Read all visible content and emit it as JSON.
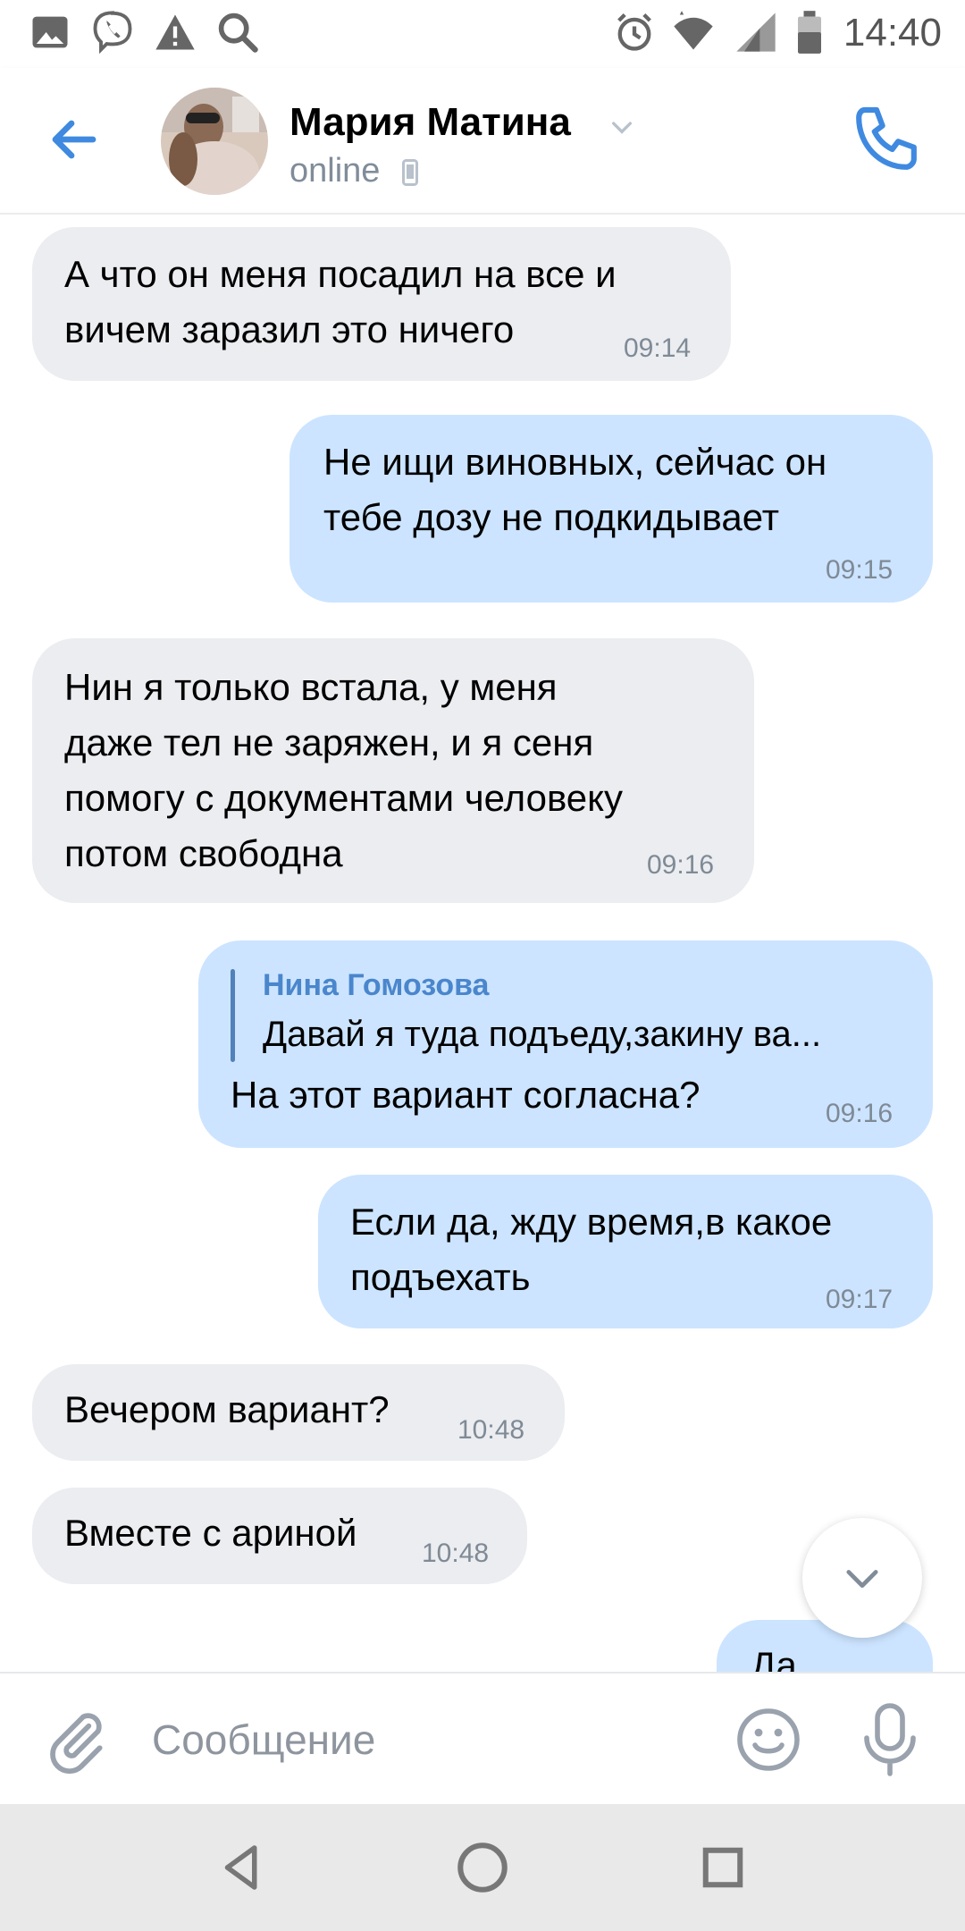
{
  "status_bar": {
    "time": "14:40",
    "icons": [
      "image-icon",
      "viber-icon",
      "warning-icon",
      "search-icon",
      "alarm-icon",
      "wifi-icon",
      "signal-icon",
      "battery-icon"
    ]
  },
  "header": {
    "back_icon": "arrow-left-icon",
    "contact_name": "Мария Матина",
    "status": "online",
    "status_icon": "phone-device-icon",
    "call_icon": "phone-icon"
  },
  "messages": [
    {
      "direction": "in",
      "text": "А что он меня посадил на все и\nвичем заразил это ничего",
      "time": "09:14"
    },
    {
      "direction": "out",
      "text": "Не ищи виновных, сейчас он\nтебе дозу не подкидывает",
      "time": "09:15"
    },
    {
      "direction": "in",
      "text": "Нин я только встала, у меня\nдаже тел не заряжен, и я сеня\nпомогу с документами человеку\nпотом свободна",
      "time": "09:16"
    },
    {
      "direction": "out",
      "reply_author": "Нина Гомозова",
      "reply_text": "Давай я туда подъеду,закину ва...",
      "text": "На этот вариант согласна?",
      "time": "09:16"
    },
    {
      "direction": "out",
      "text": "Если да, жду время,в какое\nподъехать",
      "time": "09:17"
    },
    {
      "direction": "in",
      "text": "Вечером вариант?",
      "time": "10:48"
    },
    {
      "direction": "in",
      "text": "Вместе с ариной",
      "time": "10:48"
    },
    {
      "direction": "out",
      "text": "Да",
      "time": ""
    }
  ],
  "composer": {
    "placeholder": "Сообщение",
    "attach_icon": "paperclip-icon",
    "emoji_icon": "smile-icon",
    "mic_icon": "microphone-icon"
  },
  "navbar": {
    "buttons": [
      "back-triangle-icon",
      "home-circle-icon",
      "recents-square-icon"
    ]
  },
  "colors": {
    "accent": "#4a86cc",
    "bubble_in": "#ebedf0",
    "bubble_out": "#cce4ff"
  }
}
